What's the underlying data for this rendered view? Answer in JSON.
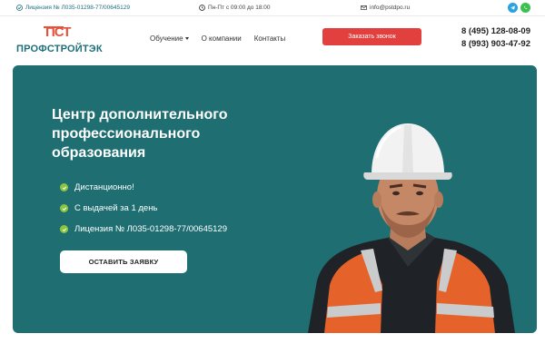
{
  "topbar": {
    "license": "Лицензия № Л035-01298-77/00645129",
    "hours": "Пн-Пт с 09:00 до 18:00",
    "email": "info@pstdpo.ru",
    "telegram_icon": "telegram-icon",
    "whatsapp_icon": "whatsapp-icon"
  },
  "header": {
    "logo_mark": "ПСТ",
    "logo_name": "ПРОФСТРОЙТЭК",
    "nav": [
      "Обучение",
      "О компании",
      "Контакты"
    ],
    "cta": "Заказать звонок",
    "phones": [
      "8 (495) 128-08-09",
      "8 (993) 903-47-92"
    ]
  },
  "hero": {
    "title": "Центр дополнительного профессионального образования",
    "features": [
      "Дистанционно!",
      "С выдачей за 1 день",
      "Лицензия № Л035-01298-77/00645129"
    ],
    "button": "ОСТАВИТЬ ЗАЯВКУ"
  },
  "colors": {
    "brand_teal": "#1e6e72",
    "accent_red": "#e2403f",
    "check_green": "#8cc63f"
  }
}
